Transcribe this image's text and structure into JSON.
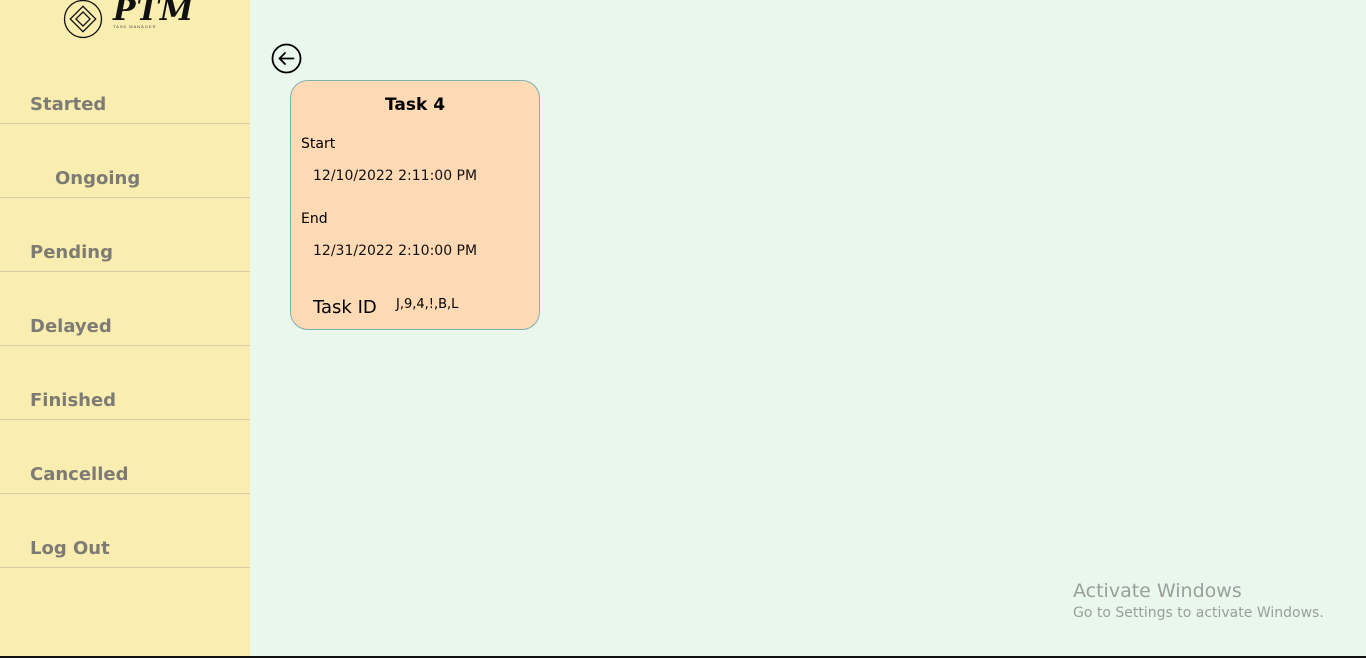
{
  "logo": {
    "text": "PTM",
    "tagline": "TASK MANAGER"
  },
  "sidebar": {
    "items": [
      {
        "label": "Started"
      },
      {
        "label": "Ongoing"
      },
      {
        "label": "Pending"
      },
      {
        "label": "Delayed"
      },
      {
        "label": "Finished"
      },
      {
        "label": "Cancelled"
      },
      {
        "label": "Log Out"
      }
    ]
  },
  "back_button": {
    "icon": "arrow-left-circle-icon"
  },
  "task": {
    "title": "Task 4",
    "start_label": "Start",
    "start_value": "12/10/2022 2:11:00 PM",
    "end_label": "End",
    "end_value": "12/31/2022 2:10:00 PM",
    "id_label": "Task ID",
    "id_value": "J,9,4,!,B,L"
  },
  "watermark": {
    "line1": "Activate Windows",
    "line2": "Go to Settings to activate Windows."
  },
  "colors": {
    "sidebar_bg": "#f9eeb0",
    "main_bg": "#eaf7ec",
    "card_bg": "#ffdab5",
    "card_border": "#7fb1b1",
    "nav_text": "#7d7b74"
  }
}
